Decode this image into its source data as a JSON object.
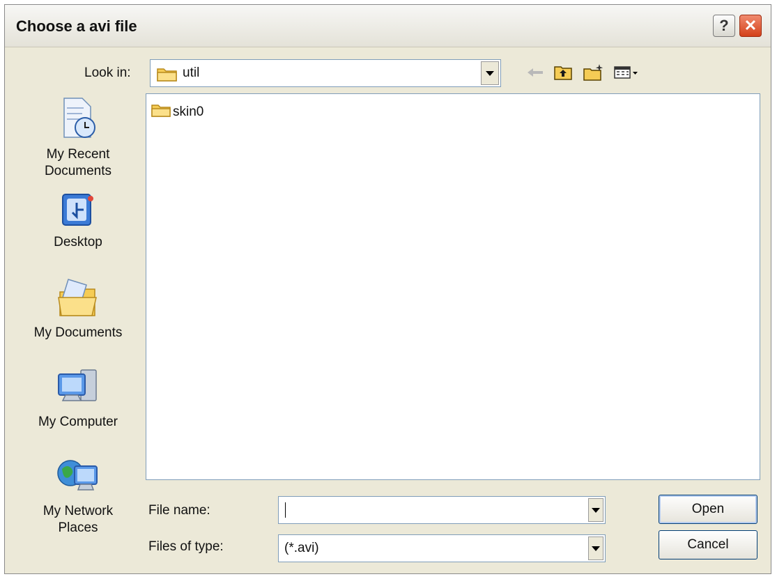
{
  "window": {
    "title": "Choose a avi file",
    "help_label": "?",
    "close_label": "✕"
  },
  "look_in": {
    "label": "Look in:",
    "value": "util"
  },
  "places": [
    {
      "label_line1": "My Recent",
      "label_line2": "Documents",
      "icon": "recent-documents-icon"
    },
    {
      "label_line1": "Desktop",
      "label_line2": "",
      "icon": "desktop-icon"
    },
    {
      "label_line1": "My Documents",
      "label_line2": "",
      "icon": "my-documents-icon"
    },
    {
      "label_line1": "My Computer",
      "label_line2": "",
      "icon": "my-computer-icon"
    },
    {
      "label_line1": "My Network",
      "label_line2": "Places",
      "icon": "network-places-icon"
    }
  ],
  "files": [
    {
      "name": "skin0",
      "icon": "folder-icon"
    }
  ],
  "file_name": {
    "label": "File name:",
    "value": ""
  },
  "file_type": {
    "label": "Files of type:",
    "value": "(*.avi)"
  },
  "buttons": {
    "open": "Open",
    "cancel": "Cancel"
  },
  "colors": {
    "dialog_bg": "#ece9d8",
    "border_blue": "#7f9db9",
    "close_red": "#d4411a",
    "folder_yellow": "#f5cc55"
  }
}
